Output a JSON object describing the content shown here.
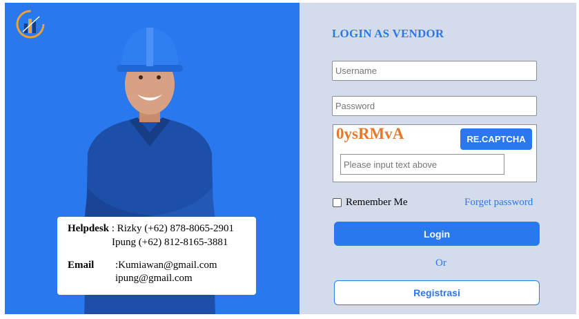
{
  "brand": {
    "logo_icon": "building-logo-icon"
  },
  "helpdesk": {
    "label": "Helpdesk",
    "line1": ": Rizky (+62) 878-8065-2901",
    "line2": "Ipung (+62) 812-8165-3881",
    "email_label": "Email",
    "email1": ":Kumiawan@gmail.com",
    "email2": "ipung@gmail.com"
  },
  "login": {
    "title": "LOGIN AS VENDOR",
    "username_placeholder": "Username",
    "password_placeholder": "Password",
    "captcha_code": "0ysRMvA",
    "recaptcha_label": "RE.CAPTCHA",
    "captcha_placeholder": "Please input text above",
    "remember_label": "Remember Me",
    "forgot_label": "Forget password",
    "login_label": "Login",
    "or_label": "Or",
    "register_label": "Registrasi"
  },
  "colors": {
    "accent": "#2a78ee",
    "panel": "#d4dceb",
    "captcha": "#e8772b"
  }
}
